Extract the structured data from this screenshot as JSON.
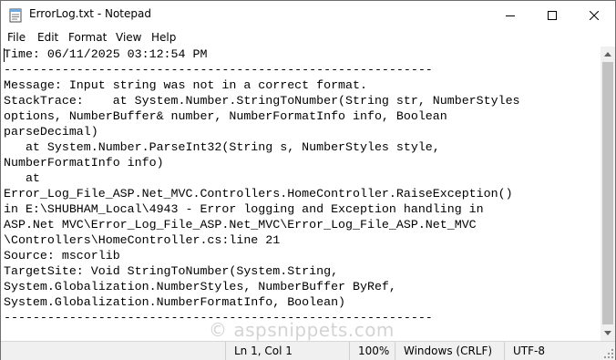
{
  "window": {
    "title": "ErrorLog.txt - Notepad",
    "icon": "notepad-icon"
  },
  "menu": {
    "file": "File",
    "edit": "Edit",
    "format": "Format",
    "view": "View",
    "help": "Help"
  },
  "editor": {
    "content": "Time: 06/11/2025 03:12:54 PM\n-----------------------------------------------------------\nMessage: Input string was not in a correct format.\nStackTrace:    at System.Number.StringToNumber(String str, NumberStyles\noptions, NumberBuffer& number, NumberFormatInfo info, Boolean\nparseDecimal)\n   at System.Number.ParseInt32(String s, NumberStyles style,\nNumberFormatInfo info)\n   at\nError_Log_File_ASP.Net_MVC.Controllers.HomeController.RaiseException()\nin E:\\SHUBHAM_Local\\4943 - Error logging and Exception handling in\nASP.Net MVC\\Error_Log_File_ASP.Net_MVC\\Error_Log_File_ASP.Net_MVC\n\\Controllers\\HomeController.cs:line 21\nSource: mscorlib\nTargetSite: Void StringToNumber(System.String,\nSystem.Globalization.NumberStyles, NumberBuffer ByRef,\nSystem.Globalization.NumberFormatInfo, Boolean)\n-----------------------------------------------------------"
  },
  "watermark": "© aspsnippets.com",
  "statusbar": {
    "position": "Ln 1, Col 1",
    "zoom": "100%",
    "line_ending": "Windows (CRLF)",
    "encoding": "UTF-8"
  }
}
